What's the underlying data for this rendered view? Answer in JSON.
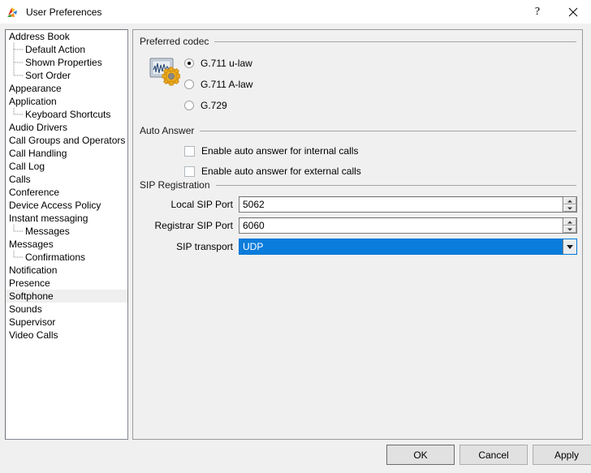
{
  "window": {
    "title": "User Preferences",
    "icon": "app-colorful-icon",
    "help_label": "?",
    "close_label": "×"
  },
  "sidebar": {
    "items": [
      {
        "label": "Address Book",
        "level": 0,
        "selected": false,
        "last_child": false
      },
      {
        "label": "Default Action",
        "level": 1,
        "selected": false,
        "last_child": false
      },
      {
        "label": "Shown Properties",
        "level": 1,
        "selected": false,
        "last_child": false
      },
      {
        "label": "Sort Order",
        "level": 1,
        "selected": false,
        "last_child": true
      },
      {
        "label": "Appearance",
        "level": 0,
        "selected": false,
        "last_child": false
      },
      {
        "label": "Application",
        "level": 0,
        "selected": false,
        "last_child": false
      },
      {
        "label": "Keyboard Shortcuts",
        "level": 1,
        "selected": false,
        "last_child": true
      },
      {
        "label": "Audio Drivers",
        "level": 0,
        "selected": false,
        "last_child": false
      },
      {
        "label": "Call Groups and Operators",
        "level": 0,
        "selected": false,
        "last_child": false
      },
      {
        "label": "Call Handling",
        "level": 0,
        "selected": false,
        "last_child": false
      },
      {
        "label": "Call Log",
        "level": 0,
        "selected": false,
        "last_child": false
      },
      {
        "label": "Calls",
        "level": 0,
        "selected": false,
        "last_child": false
      },
      {
        "label": "Conference",
        "level": 0,
        "selected": false,
        "last_child": false
      },
      {
        "label": "Device Access Policy",
        "level": 0,
        "selected": false,
        "last_child": false
      },
      {
        "label": "Instant messaging",
        "level": 0,
        "selected": false,
        "last_child": false
      },
      {
        "label": "Messages",
        "level": 1,
        "selected": false,
        "last_child": true
      },
      {
        "label": "Messages",
        "level": 0,
        "selected": false,
        "last_child": false
      },
      {
        "label": "Confirmations",
        "level": 1,
        "selected": false,
        "last_child": true
      },
      {
        "label": "Notification",
        "level": 0,
        "selected": false,
        "last_child": false
      },
      {
        "label": "Presence",
        "level": 0,
        "selected": false,
        "last_child": false
      },
      {
        "label": "Softphone",
        "level": 0,
        "selected": true,
        "last_child": false
      },
      {
        "label": "Sounds",
        "level": 0,
        "selected": false,
        "last_child": false
      },
      {
        "label": "Supervisor",
        "level": 0,
        "selected": false,
        "last_child": false
      },
      {
        "label": "Video Calls",
        "level": 0,
        "selected": false,
        "last_child": false
      }
    ]
  },
  "codec_group": {
    "title": "Preferred codec",
    "icon": "audio-codec-settings-icon",
    "options": [
      {
        "label": "G.711 u-law",
        "selected": true
      },
      {
        "label": "G.711 A-law",
        "selected": false
      },
      {
        "label": "G.729",
        "selected": false
      }
    ]
  },
  "auto_answer_group": {
    "title": "Auto Answer",
    "checkboxes": [
      {
        "label": "Enable auto answer for internal calls",
        "checked": false
      },
      {
        "label": "Enable auto answer for external calls",
        "checked": false
      }
    ]
  },
  "sip_group": {
    "title": "SIP Registration",
    "local_port": {
      "label": "Local SIP Port",
      "value": "5062"
    },
    "registrar_port": {
      "label": "Registrar SIP Port",
      "value": "6060"
    },
    "transport": {
      "label": "SIP transport",
      "value": "UDP"
    }
  },
  "buttons": {
    "ok": "OK",
    "cancel": "Cancel",
    "apply": "Apply"
  },
  "colors": {
    "accent": "#0a7cdb",
    "dialog_bg": "#f0f0f0",
    "selection_bg": "#efefef"
  }
}
